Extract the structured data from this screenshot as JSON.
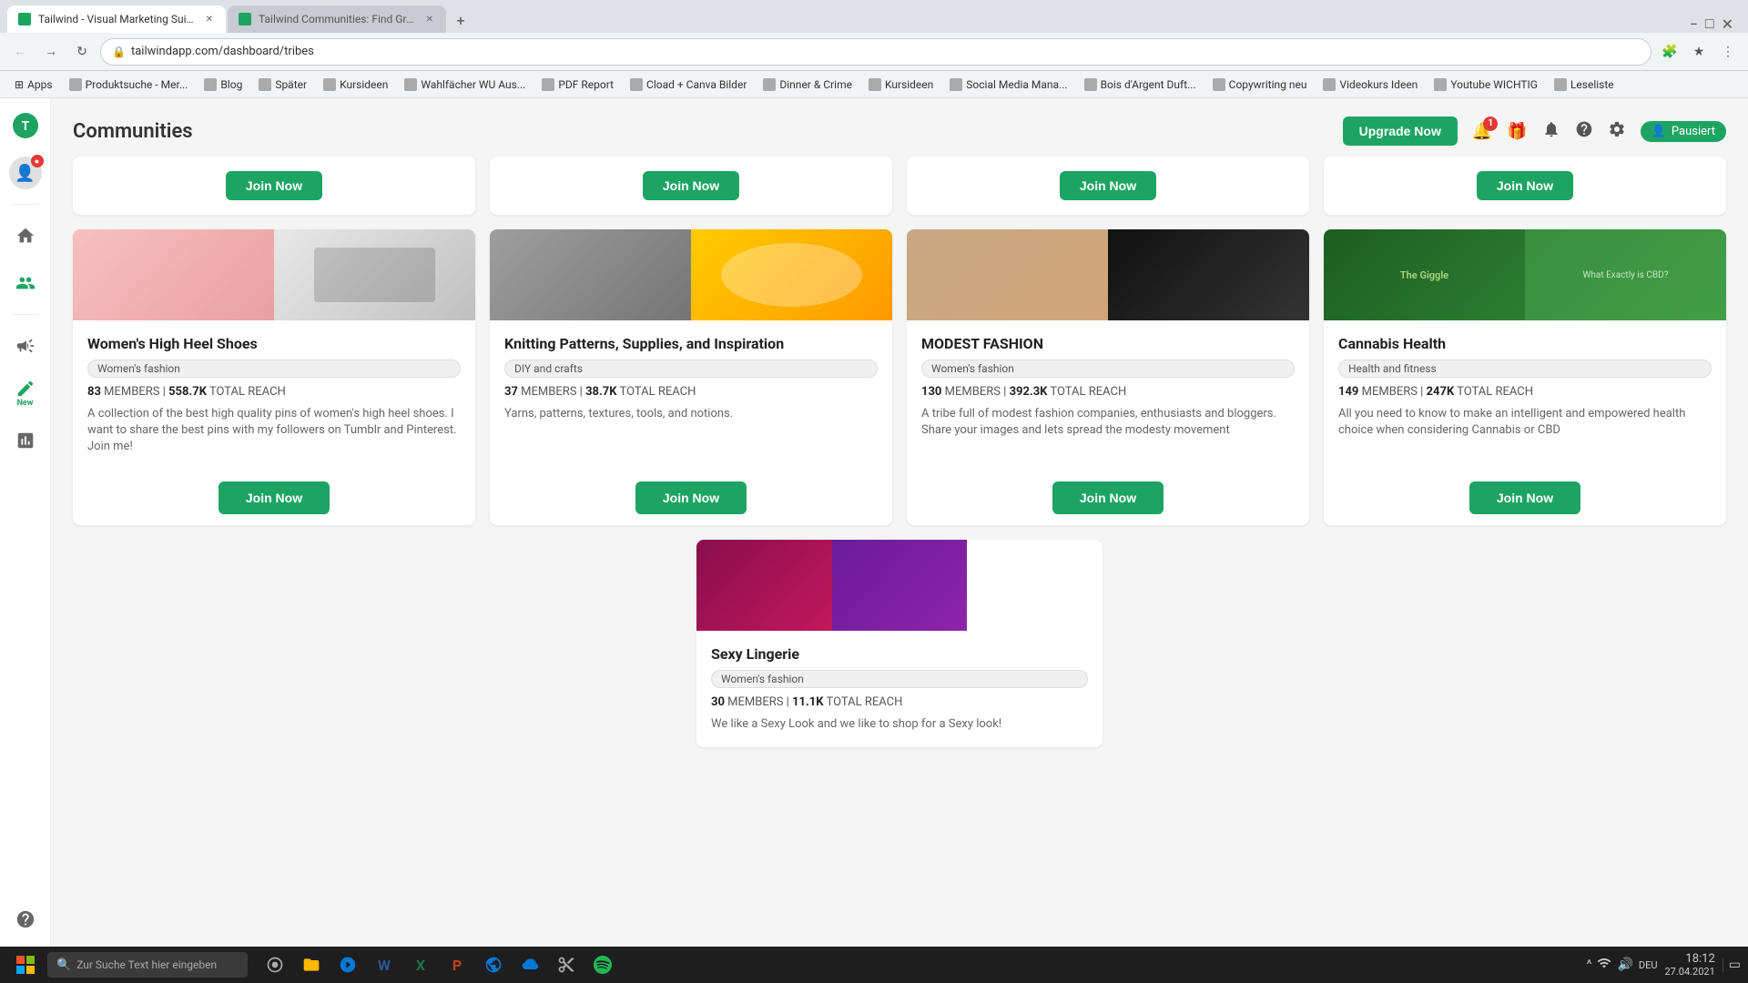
{
  "browser": {
    "tabs": [
      {
        "id": "tab1",
        "title": "Tailwind - Visual Marketing Suite...",
        "url": "tailwindapp.com/dashboard/tribes",
        "active": true
      },
      {
        "id": "tab2",
        "title": "Tailwind Communities: Find Gre...",
        "url": "",
        "active": false
      }
    ],
    "address": "tailwindapp.com/dashboard/tribes",
    "bookmarks": [
      {
        "label": "Apps",
        "icon": "apps"
      },
      {
        "label": "Produktsuche - Mer..."
      },
      {
        "label": "Blog"
      },
      {
        "label": "Später"
      },
      {
        "label": "Kursideen"
      },
      {
        "label": "Wahlfächer WU Aus..."
      },
      {
        "label": "PDF Report"
      },
      {
        "label": "Cload + Canva Bilder"
      },
      {
        "label": "Dinner & Crime"
      },
      {
        "label": "Kursideen"
      },
      {
        "label": "Social Media Mana..."
      },
      {
        "label": "Bois d'Argent Duft..."
      },
      {
        "label": "Copywriting neu"
      },
      {
        "label": "Videokurs Ideen"
      },
      {
        "label": "Youtube WICHTIG"
      },
      {
        "label": "Leseliste"
      }
    ]
  },
  "header": {
    "title": "Communities",
    "upgrade_label": "Upgrade Now",
    "notification_count": "1",
    "profile_label": "Pausiert"
  },
  "sidebar": {
    "items": [
      {
        "id": "logo",
        "icon": "🏠",
        "label": "Logo"
      },
      {
        "id": "avatar",
        "icon": "👤",
        "label": "Avatar"
      },
      {
        "id": "home",
        "icon": "🏠",
        "label": "Home"
      },
      {
        "id": "people",
        "icon": "👥",
        "label": "Communities"
      },
      {
        "id": "divider"
      },
      {
        "id": "megaphone",
        "icon": "📣",
        "label": "Publish"
      },
      {
        "id": "new",
        "icon": "✏️",
        "label": "New",
        "badge": "New"
      },
      {
        "id": "chart",
        "icon": "📊",
        "label": "Analytics"
      }
    ]
  },
  "top_cards": [
    {
      "id": "top1"
    },
    {
      "id": "top2"
    },
    {
      "id": "top3"
    },
    {
      "id": "top4"
    }
  ],
  "main_cards": [
    {
      "id": "card1",
      "title": "Women's High Heel Shoes",
      "tag": "Women's fashion",
      "members": "83",
      "total_reach": "558.7K",
      "description": "A collection of the best high quality pins of women's high heel shoes. I want to share the best pins with my followers on Tumblr and Pinterest. Join me!",
      "join_label": "Join Now",
      "img1_class": "img-heels1",
      "img2_class": "img-heels2"
    },
    {
      "id": "card2",
      "title": "Knitting Patterns, Supplies, and Inspiration",
      "tag": "DIY and crafts",
      "members": "37",
      "total_reach": "38.7K",
      "description": "Yarns, patterns, textures, tools, and notions.",
      "join_label": "Join Now",
      "img1_class": "img-knit1",
      "img2_class": "img-knit2"
    },
    {
      "id": "card3",
      "title": "MODEST FASHION",
      "tag": "Women's fashion",
      "members": "130",
      "total_reach": "392.3K",
      "description": "A tribe full of modest fashion companies, enthusiasts and bloggers. Share your images and lets spread the modesty movement",
      "join_label": "Join Now",
      "img1_class": "img-modest1",
      "img2_class": "img-modest2"
    },
    {
      "id": "card4",
      "title": "Cannabis Health",
      "tag": "Health and fitness",
      "members": "149",
      "total_reach": "247K",
      "description": "All you need to know to make an intelligent and empowered health choice when considering Cannabis or CBD",
      "join_label": "Join Now",
      "img1_class": "img-cannabis1",
      "img2_class": "img-cannabis2"
    }
  ],
  "bottom_card": {
    "id": "bottom1",
    "title": "Sexy Lingerie",
    "tag": "Women's fashion",
    "members": "30",
    "total_reach": "11.1K",
    "description": "We like a Sexy Look and we like to shop for a Sexy look!",
    "join_label": "Join Now"
  },
  "join_now_top_labels": [
    "Join Now",
    "Join Now",
    "Join Now",
    "Join Now"
  ],
  "taskbar": {
    "search_placeholder": "Zur Suche Text hier eingeben",
    "time": "18:12",
    "date": "27.04.2021",
    "keyboard_lang": "DEU"
  }
}
